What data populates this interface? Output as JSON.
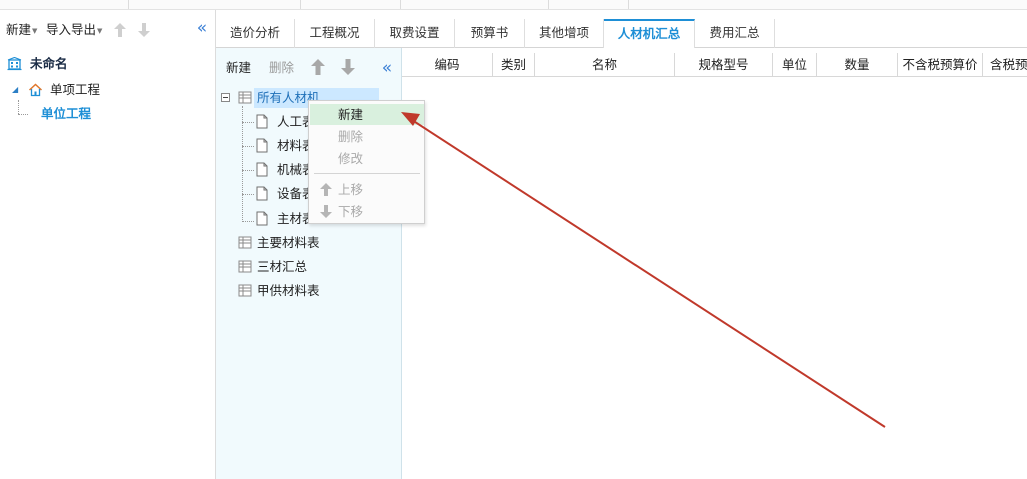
{
  "left_panel": {
    "toolbar": {
      "new_label": "新建",
      "import_export_label": "导入导出"
    },
    "tree": {
      "root": "未命名",
      "single_project": "单项工程",
      "unit_project": "单位工程"
    }
  },
  "tabs": [
    {
      "label": "造价分析"
    },
    {
      "label": "工程概况"
    },
    {
      "label": "取费设置"
    },
    {
      "label": "预算书"
    },
    {
      "label": "其他增项"
    },
    {
      "label": "人材机汇总",
      "active": true
    },
    {
      "label": "费用汇总"
    }
  ],
  "category_panel": {
    "toolbar": {
      "new_label": "新建",
      "delete_label": "删除"
    },
    "items": [
      {
        "label": "所有人材机",
        "selected": true
      },
      {
        "label": "人工表"
      },
      {
        "label": "材料表"
      },
      {
        "label": "机械表"
      },
      {
        "label": "设备表"
      },
      {
        "label": "主材表"
      },
      {
        "label": "主要材料表"
      },
      {
        "label": "三材汇总"
      },
      {
        "label": "甲供材料表"
      }
    ]
  },
  "table": {
    "columns": [
      "编码",
      "类别",
      "名称",
      "规格型号",
      "单位",
      "数量",
      "不含税预算价",
      "含税预"
    ]
  },
  "context_menu": {
    "items": [
      {
        "label": "新建",
        "state": "highlighted"
      },
      {
        "label": "删除",
        "state": "disabled"
      },
      {
        "label": "修改",
        "state": "disabled"
      },
      {
        "label": "上移",
        "state": "disabled"
      },
      {
        "label": "下移",
        "state": "disabled"
      }
    ]
  },
  "colors": {
    "accent": "#1e8fd6",
    "annotation_arrow": "#c0392b",
    "category_panel_bg": "#f1fafd",
    "menu_highlight": "#d9f0de",
    "selected_item_bg": "#cce8ff"
  },
  "icons": {
    "collapse": "double-chevron-left-icon",
    "move_up": "arrow-up-icon",
    "move_down": "arrow-down-icon",
    "document": "document-icon",
    "table": "table-icon",
    "building": "building-icon",
    "house": "house-icon"
  }
}
